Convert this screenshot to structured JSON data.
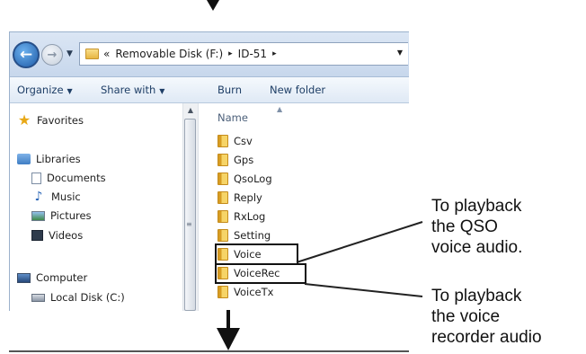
{
  "explorer": {
    "address": {
      "prefix": "«",
      "parts": [
        "Removable Disk (F:)",
        "ID-51"
      ],
      "separator": "▸"
    },
    "toolbar": {
      "organize": "Organize",
      "share_with": "Share with",
      "burn": "Burn",
      "new_folder": "New folder"
    },
    "nav": {
      "favorites": "Favorites",
      "libraries": "Libraries",
      "documents": "Documents",
      "music": "Music",
      "pictures": "Pictures",
      "videos": "Videos",
      "computer": "Computer",
      "local_disk": "Local Disk (C:)"
    },
    "filelist": {
      "column_name": "Name",
      "folders": [
        "Csv",
        "Gps",
        "QsoLog",
        "Reply",
        "RxLog",
        "Setting",
        "Voice",
        "VoiceRec",
        "VoiceTx"
      ]
    }
  },
  "annotations": {
    "qso": [
      "To playback",
      "the QSO",
      "voice audio."
    ],
    "recorder": [
      "To playback",
      "the voice",
      "recorder audio"
    ]
  },
  "icons": {
    "top_arrow": "arrow-down-icon",
    "bottom_arrow": "arrow-down-icon"
  }
}
